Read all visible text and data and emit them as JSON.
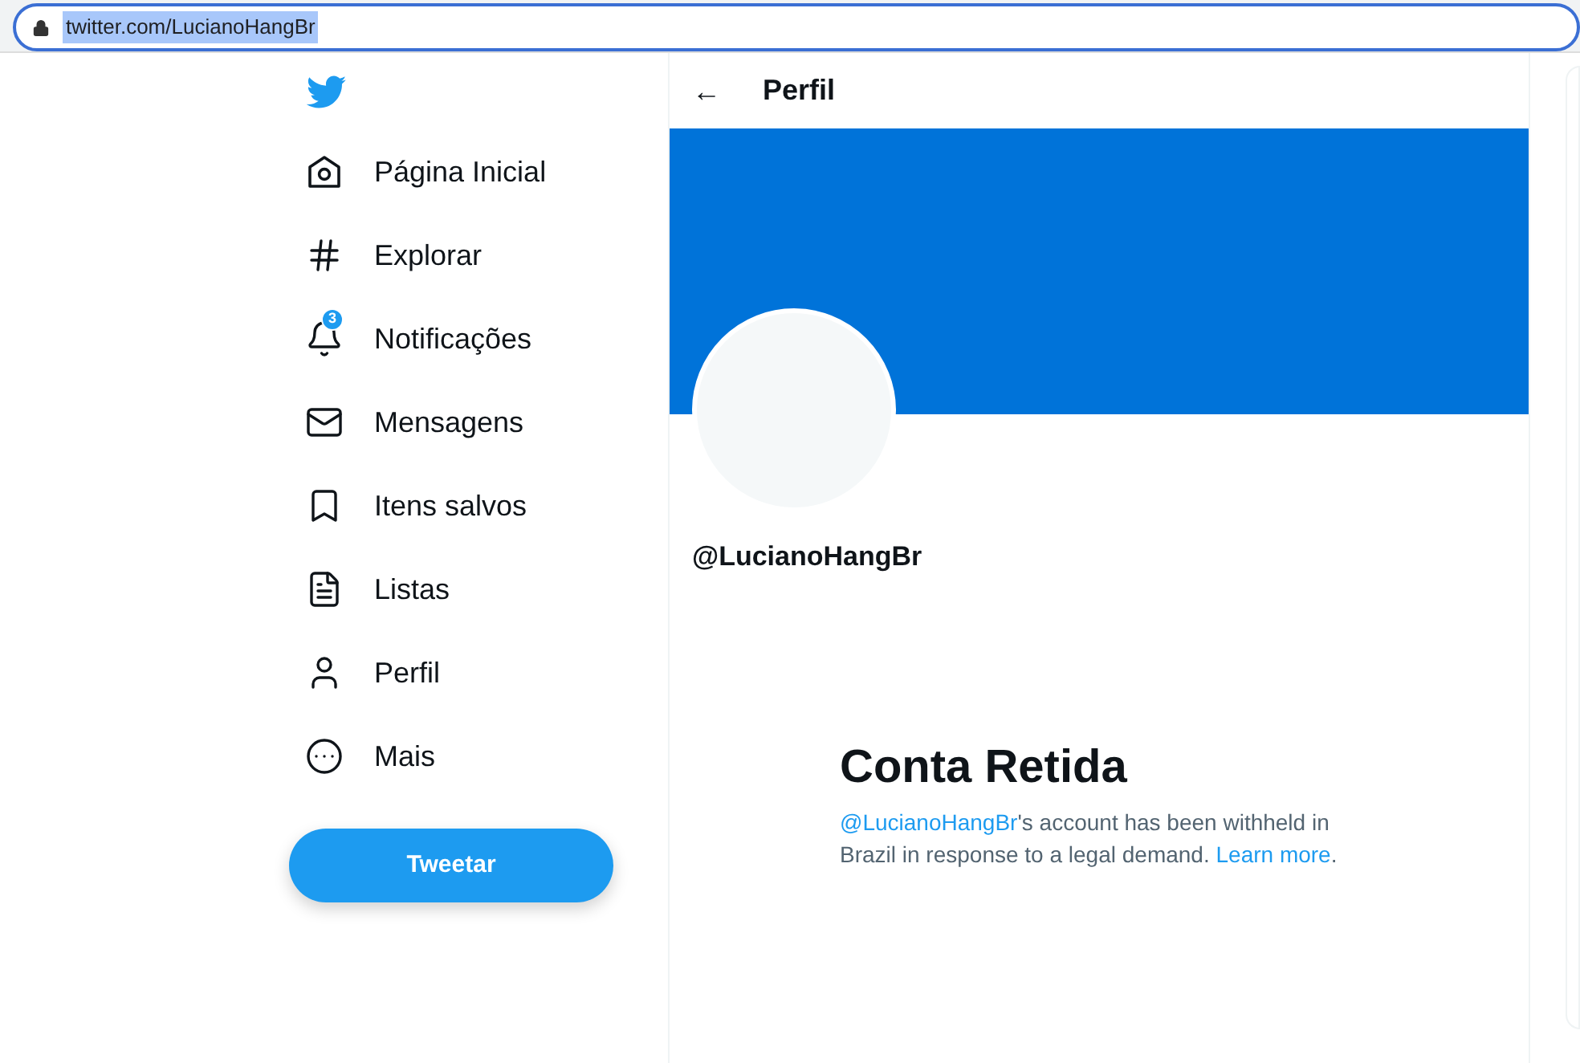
{
  "address_bar": {
    "url": "twitter.com/LucianoHangBr"
  },
  "sidebar": {
    "items": [
      {
        "label": "Página Inicial"
      },
      {
        "label": "Explorar"
      },
      {
        "label": "Notificações",
        "badge": "3"
      },
      {
        "label": "Mensagens"
      },
      {
        "label": "Itens salvos"
      },
      {
        "label": "Listas"
      },
      {
        "label": "Perfil"
      },
      {
        "label": "Mais"
      }
    ],
    "tweet_button": "Tweetar"
  },
  "header": {
    "back": "←",
    "title": "Perfil"
  },
  "profile": {
    "handle": "@LucianoHangBr"
  },
  "withheld": {
    "title": "Conta Retida",
    "handle_link": "@LucianoHangBr",
    "text": "'s account has been withheld in Brazil in response to a legal demand. ",
    "link": "Learn more",
    "end": "."
  }
}
